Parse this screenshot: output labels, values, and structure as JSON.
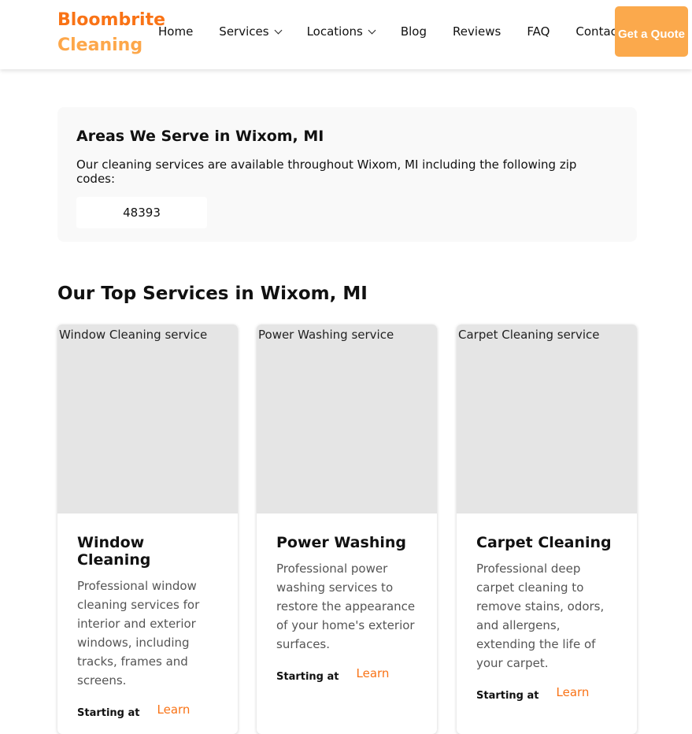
{
  "header": {
    "logo_line1": "Bloombrite",
    "logo_line2": "Cleaning",
    "nav": [
      "Home",
      "Services",
      "Locations",
      "Blog",
      "Reviews",
      "FAQ",
      "Contact"
    ],
    "quote": "Get a Quote"
  },
  "areas": {
    "title": "Areas We Serve in Wixom, MI",
    "text": "Our cleaning services are available throughout Wixom, MI including the following zip codes:",
    "zips": [
      "48393"
    ]
  },
  "services": {
    "title": "Our Top Services in Wixom, MI",
    "cards": [
      {
        "alt": "Window Cleaning service",
        "title": "Window Cleaning",
        "desc": "Professional window cleaning services for interior and exterior windows, including tracks, frames and screens.",
        "starting": "Starting at",
        "learn": "Learn"
      },
      {
        "alt": "Power Washing service",
        "title": "Power Washing",
        "desc": "Professional power washing services to restore the appearance of your home's exterior surfaces.",
        "starting": "Starting at",
        "learn": "Learn"
      },
      {
        "alt": "Carpet Cleaning service",
        "title": "Carpet Cleaning",
        "desc": "Professional deep carpet cleaning to remove stains, odors, and allergens, extending the life of your carpet.",
        "starting": "Starting at",
        "learn": "Learn"
      }
    ]
  }
}
